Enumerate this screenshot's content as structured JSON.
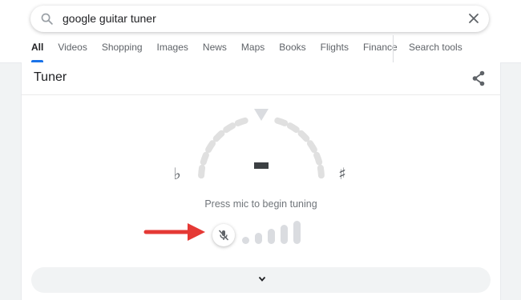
{
  "search": {
    "query": "google guitar tuner"
  },
  "nav": {
    "tabs": [
      {
        "label": "All",
        "active": true
      },
      {
        "label": "Videos"
      },
      {
        "label": "Shopping"
      },
      {
        "label": "Images"
      },
      {
        "label": "News"
      },
      {
        "label": "Maps"
      },
      {
        "label": "Books"
      },
      {
        "label": "Flights"
      },
      {
        "label": "Finance"
      }
    ],
    "tools_label": "Search tools"
  },
  "tuner": {
    "title": "Tuner",
    "note": "–",
    "flat_symbol": "♭",
    "sharp_symbol": "♯",
    "status": "Press mic to begin tuning",
    "mic_state": "muted",
    "level_bars": 5,
    "level": 0
  },
  "colors": {
    "accent": "#1a73e8",
    "arrow": "#e53935",
    "gauge_segment": "#e0e0e0",
    "indicator": "#dadce0",
    "note": "#3c4043"
  },
  "icons": {
    "search": "search-icon",
    "clear": "close-icon",
    "share": "share-icon",
    "mic": "mic-off-icon",
    "expand": "chevron-down-icon"
  }
}
